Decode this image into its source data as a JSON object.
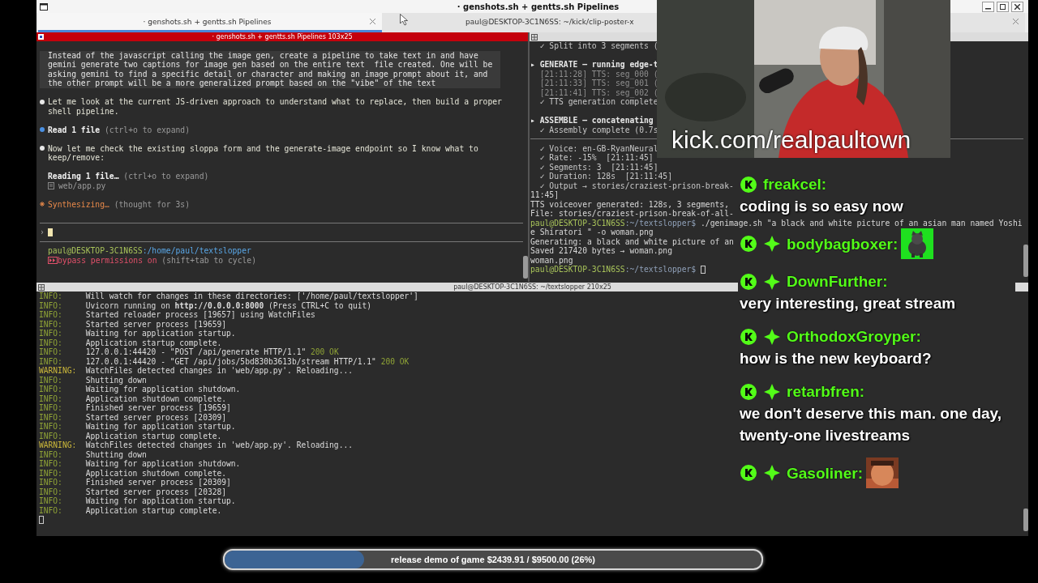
{
  "window": {
    "title": "· genshots.sh + gentts.sh Pipelines"
  },
  "tabs": [
    {
      "label": "· genshots.sh + gentts.sh Pipelines",
      "selected": true
    },
    {
      "label": "paul@DESKTOP-3C1N6SS: ~/kick/clip-poster-x",
      "selected": false
    }
  ],
  "left_pane": {
    "title": "· genshots.sh + gentts.sh Pipelines 103x25",
    "items": [
      {
        "kind": "user",
        "text": "Instead of the javascript calling the image gen, create a pipeline to take text in and have\ngemini generate two captions for image gen based on the entire text  file created. One will be\nasking gemini to find a specific detail or character and making an image prompt about it, and\nthe other prompt will be a more generalized prompt based on the \"vibe\" of the text"
      },
      {
        "kind": "bullet",
        "color": "#e8e8e8",
        "text": "Let me look at the current JS-driven approach to understand what to replace, then build a proper\nshell pipeline."
      },
      {
        "kind": "bullet",
        "color": "#4a90e2",
        "title": "Read 1 file",
        "hint": "(ctrl+o to expand)"
      },
      {
        "kind": "bullet",
        "color": "#e8e8e8",
        "text": "Now let me check the existing sloppa form and the generate-image endpoint so I know what to\nkeep/remove:"
      },
      {
        "kind": "tool",
        "title": "Reading 1 file…",
        "hint": "(ctrl+o to expand)",
        "file": "web/app.py"
      },
      {
        "kind": "status",
        "title": "Synthesizing…",
        "hint": "(thought for 3s)"
      }
    ],
    "prompt": {
      "symbol": "›"
    },
    "footer": {
      "user": "paul@DESKTOP-3C1N6SS",
      "path": ":/home/paul/textslopper",
      "mode": "bypass permissions on",
      "hint": "(shift+tab to cycle)"
    }
  },
  "right_pane": {
    "lines": [
      {
        "kind": "check",
        "text": "  ✓ Split into 3 segments ("
      },
      {
        "kind": "gap"
      },
      {
        "kind": "header",
        "text": "▸ GENERATE — running edge-t"
      },
      {
        "kind": "log",
        "text": "  [21:11:28] TTS: seg_000 ("
      },
      {
        "kind": "log",
        "text": "  [21:11:33] TTS: seg_001 ("
      },
      {
        "kind": "log",
        "text": "  [21:11:41] TTS: seg_002 ("
      },
      {
        "kind": "check",
        "text": "  ✓ TTS generation complete"
      },
      {
        "kind": "gap"
      },
      {
        "kind": "header",
        "text": "▸ ASSEMBLE — concatenating"
      },
      {
        "kind": "check",
        "text": "  ✓ Assembly complete (0.7s"
      },
      {
        "kind": "rule"
      },
      {
        "kind": "check",
        "text": "  ✓ Voice: en-GB-RyanNeural"
      },
      {
        "kind": "check",
        "text": "  ✓ Rate: -15%  [21:11:45]"
      },
      {
        "kind": "check",
        "text": "  ✓ Segments: 3  [21:11:45]"
      },
      {
        "kind": "check",
        "text": "  ✓ Duration: 128s  [21:11:45]"
      },
      {
        "kind": "check",
        "text": "  ✓ Output → stories/craziest-prison-break-"
      },
      {
        "kind": "plain",
        "text": "11:45]"
      },
      {
        "kind": "plain",
        "text": "TTS voiceover generated: 128s, 3 segments,"
      },
      {
        "kind": "plain",
        "text": "File: stories/craziest-prison-break-of-all-"
      },
      {
        "kind": "prompt",
        "user": "paul@DESKTOP-3C1N6SS",
        "path": ":~/textslopper$",
        "text": " ./genimage.sh \"a black and white picture of an asian man named Yoshi"
      },
      {
        "kind": "plain",
        "text": "e Shiratori \" -o woman.png"
      },
      {
        "kind": "plain",
        "text": "Generating: a black and white picture of an"
      },
      {
        "kind": "plain",
        "text": "Saved 217420 bytes → woman.png"
      },
      {
        "kind": "plain",
        "text": "woman.png"
      },
      {
        "kind": "prompt",
        "user": "paul@DESKTOP-3C1N6SS",
        "path": ":~/textslopper$",
        "cursor": true
      }
    ]
  },
  "bottom_pane": {
    "title": "paul@DESKTOP-3C1N6SS: ~/textslopper 210x25",
    "lines": [
      {
        "level": "INFO:",
        "message": "Will watch for changes in these directories: ['/home/paul/textslopper']"
      },
      {
        "level": "INFO:",
        "message": "Uvicorn running on **http://0.0.0.0:8000** (Press CTRL+C to quit)"
      },
      {
        "level": "INFO:",
        "message": "Started reloader process [19657] using WatchFiles"
      },
      {
        "level": "INFO:",
        "message": "Started server process [19659]"
      },
      {
        "level": "INFO:",
        "message": "Waiting for application startup."
      },
      {
        "level": "INFO:",
        "message": "Application startup complete."
      },
      {
        "level": "INFO:",
        "message": "127.0.0.1:44420 - \"POST /api/generate HTTP/1.1\"",
        "status": "200 OK"
      },
      {
        "level": "INFO:",
        "message": "127.0.0.1:44420 - \"GET /api/jobs/5bd830b3613b/stream HTTP/1.1\"",
        "status": "200 OK"
      },
      {
        "level": "WARNING:",
        "message": "WatchFiles detected changes in 'web/app.py'. Reloading..."
      },
      {
        "level": "INFO:",
        "message": "Shutting down"
      },
      {
        "level": "INFO:",
        "message": "Waiting for application shutdown."
      },
      {
        "level": "INFO:",
        "message": "Application shutdown complete."
      },
      {
        "level": "INFO:",
        "message": "Finished server process [19659]"
      },
      {
        "level": "INFO:",
        "message": "Started server process [20309]"
      },
      {
        "level": "INFO:",
        "message": "Waiting for application startup."
      },
      {
        "level": "INFO:",
        "message": "Application startup complete."
      },
      {
        "level": "WARNING:",
        "message": "WatchFiles detected changes in 'web/app.py'. Reloading..."
      },
      {
        "level": "INFO:",
        "message": "Shutting down"
      },
      {
        "level": "INFO:",
        "message": "Waiting for application shutdown."
      },
      {
        "level": "INFO:",
        "message": "Application shutdown complete."
      },
      {
        "level": "INFO:",
        "message": "Finished server process [20309]"
      },
      {
        "level": "INFO:",
        "message": "Started server process [20328]"
      },
      {
        "level": "INFO:",
        "message": "Waiting for application startup."
      },
      {
        "level": "INFO:",
        "message": "Application startup complete."
      }
    ]
  },
  "webcam": {
    "caption": "kick.com/realpaultown"
  },
  "chat": [
    {
      "kind": "text",
      "user": "freakcel:",
      "subscriber": false,
      "message": "coding is so easy now"
    },
    {
      "kind": "emote",
      "user": "bodybagboxer:",
      "subscriber": true
    },
    {
      "kind": "text",
      "user": "DownFurther:",
      "subscriber": true,
      "message": "very interesting, great stream"
    },
    {
      "kind": "text",
      "user": "OrthodoxGroyper:",
      "subscriber": true,
      "message": "how is the new keyboard?"
    },
    {
      "kind": "text",
      "user": "retarbfren:",
      "subscriber": true,
      "message": "we don't deserve this man. one day, twenty-one livestreams"
    },
    {
      "kind": "emote",
      "user": "Gasoliner:",
      "subscriber": true
    }
  ],
  "goal": {
    "text": "release demo of game $2439.91 / $9500.00 (26%)",
    "level": 0.26
  }
}
